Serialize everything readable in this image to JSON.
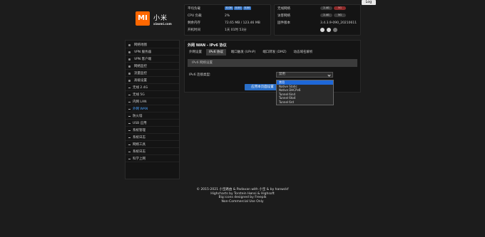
{
  "logout_label": "Log",
  "brand": {
    "mi": "MI",
    "cn": "小米",
    "url": "xiaomi.com"
  },
  "status1": {
    "rows": [
      {
        "label": "平均负载",
        "chips": [
          "0.08",
          "0.00",
          "0.00"
        ]
      },
      {
        "label": "CPU 负载",
        "value": "2%"
      },
      {
        "label": "剩余内存",
        "value": "72.65 MB / 123.46 MB"
      },
      {
        "label": "开机时间",
        "value": "1天 01时 53分"
      }
    ]
  },
  "status2": {
    "rows": [
      {
        "label": "无线网络",
        "pill1": "2.4G",
        "pill2": "5G"
      },
      {
        "label": "访客网络",
        "pill1": "2.4G",
        "pill2": "5G"
      },
      {
        "label": "固件版本",
        "value": "3.4.3.9-090_20210611"
      },
      {
        "label": ""
      }
    ]
  },
  "sidebar": {
    "items": [
      {
        "label": "网络地图"
      },
      {
        "label": "VPN 服务器"
      },
      {
        "label": "VPN 客户端"
      },
      {
        "label": "网络监控"
      },
      {
        "label": "流量监控"
      },
      {
        "label": "高级设置"
      },
      {
        "label": "无线 2.4G"
      },
      {
        "label": "无线 5G"
      },
      {
        "label": "内网 LAN"
      },
      {
        "label": "外网 WAN"
      },
      {
        "label": "防火墙"
      },
      {
        "label": "USB 应用"
      },
      {
        "label": "系统管理"
      },
      {
        "label": "系统日志"
      },
      {
        "label": "网络工具"
      },
      {
        "label": "系统日志"
      },
      {
        "label": "科学上网"
      }
    ]
  },
  "main": {
    "title": "外网 WAN - IPv6 协议",
    "tabs": [
      "外网设置",
      "IPv6 协议",
      "端口触发 (UPnP)",
      "端口转发 (DMZ)",
      "动态域名解析"
    ],
    "section": "IPv6 网络设置",
    "field_label": "IPv6 连接类型:",
    "select_value": "禁用",
    "save_label": "应用本页面设置"
  },
  "dropdown": {
    "options": [
      "禁用",
      "Native Static",
      "Native DHCPv6",
      "Tunnel 6in4",
      "Tunnel 6to4",
      "Tunnel 6rd"
    ],
    "selected": 0
  },
  "footer": {
    "lines": [
      "© 2015-2021 小宝路由 & Padavan with 小宝 & by hanwckf",
      "Highcharts by Torstein Hønsi & Highsoft",
      "Big icons designed by Freepik",
      "Non-Commercial Use Only"
    ]
  }
}
